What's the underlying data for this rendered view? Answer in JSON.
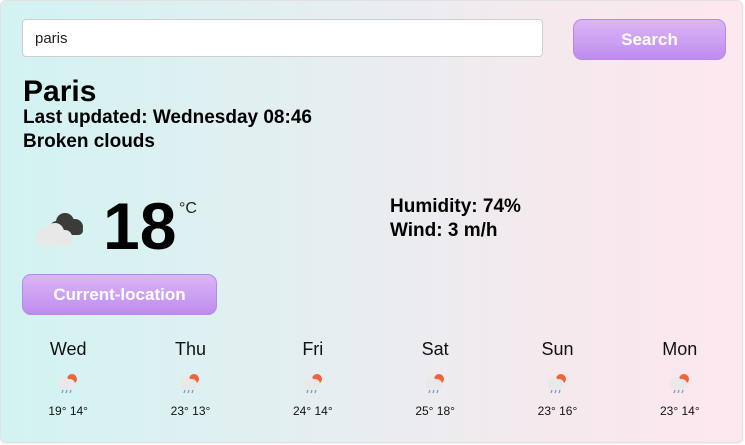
{
  "search": {
    "value": "paris",
    "button_label": "Search"
  },
  "current": {
    "city": "Paris",
    "last_updated": "Last updated: Wednesday 08:46",
    "description": "Broken clouds",
    "temperature": "18",
    "unit": "°C",
    "humidity": "Humidity: 74%",
    "wind": "Wind: 3 m/h",
    "icon": "broken-clouds-icon"
  },
  "location_button_label": "Current-location",
  "forecast": [
    {
      "day": "Wed",
      "temps": "19° 14°",
      "icon": "rain-sun-icon"
    },
    {
      "day": "Thu",
      "temps": "23° 13°",
      "icon": "rain-sun-icon"
    },
    {
      "day": "Fri",
      "temps": "24° 14°",
      "icon": "rain-sun-icon"
    },
    {
      "day": "Sat",
      "temps": "25° 18°",
      "icon": "rain-sun-icon"
    },
    {
      "day": "Sun",
      "temps": "23° 16°",
      "icon": "rain-sun-icon"
    },
    {
      "day": "Mon",
      "temps": "23° 14°",
      "icon": "rain-sun-icon"
    }
  ],
  "colors": {
    "accent": "#c596f0",
    "gradient_left": "#d2f3f2",
    "gradient_right": "#fde8ee"
  }
}
